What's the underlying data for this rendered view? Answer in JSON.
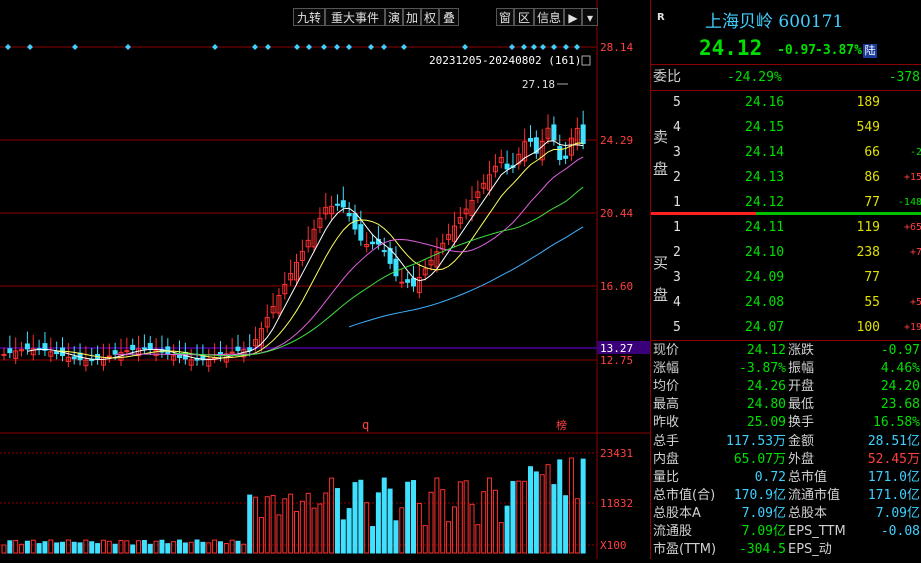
{
  "toolbar": {
    "items": [
      "九转",
      "重大事件",
      "演",
      "加",
      "权",
      "叠",
      "窗",
      "区",
      "信息"
    ]
  },
  "chart": {
    "price_ticks": [
      "28.14",
      "24.29",
      "20.44",
      "16.60",
      "12.75"
    ],
    "current_price_tag": "13.27",
    "range_label": "20231205-20240802 (161)",
    "high_label": "27.18",
    "q_marker": "q",
    "bang_marker": "榜",
    "vol_ticks": [
      "23431",
      "11832",
      "X100"
    ]
  },
  "quote": {
    "flag": "R",
    "name": "上海贝岭 600171",
    "price": "24.12",
    "change": "-0.97",
    "change_pct": "-3.87%",
    "market_badge": "陆",
    "weibi_label": "委比",
    "weibi": "-24.29%",
    "weicha": "-378",
    "sell_word": [
      "卖",
      "盘"
    ],
    "buy_word": [
      "买",
      "盘"
    ],
    "asks": [
      {
        "n": "5",
        "price": "24.16",
        "vol": "189",
        "chg": ""
      },
      {
        "n": "4",
        "price": "24.15",
        "vol": "549",
        "chg": ""
      },
      {
        "n": "3",
        "price": "24.14",
        "vol": "66",
        "chg": "-2"
      },
      {
        "n": "2",
        "price": "24.13",
        "vol": "86",
        "chg": "+15"
      },
      {
        "n": "1",
        "price": "24.12",
        "vol": "77",
        "chg": "-148"
      }
    ],
    "bids": [
      {
        "n": "1",
        "price": "24.11",
        "vol": "119",
        "chg": "+65"
      },
      {
        "n": "2",
        "price": "24.10",
        "vol": "238",
        "chg": "+7"
      },
      {
        "n": "3",
        "price": "24.09",
        "vol": "77",
        "chg": ""
      },
      {
        "n": "4",
        "price": "24.08",
        "vol": "55",
        "chg": "+5"
      },
      {
        "n": "5",
        "price": "24.07",
        "vol": "100",
        "chg": "+19"
      }
    ],
    "stats": [
      [
        "现价",
        "24.12",
        "涨跌",
        "-0.97"
      ],
      [
        "涨幅",
        "-3.87%",
        "振幅",
        "4.46%"
      ],
      [
        "均价",
        "24.26",
        "开盘",
        "24.20"
      ],
      [
        "最高",
        "24.80",
        "最低",
        "23.68"
      ],
      [
        "昨收",
        "25.09",
        "换手",
        "16.58%"
      ],
      [
        "总手",
        "117.53万",
        "金额",
        "28.51亿"
      ],
      [
        "内盘",
        "65.07万",
        "外盘",
        "52.45万"
      ],
      [
        "量比",
        "0.72",
        "总市值",
        "171.0亿"
      ],
      [
        "总市值(合)",
        "170.9亿",
        "流通市值",
        "171.0亿"
      ],
      [
        "总股本A",
        "7.09亿",
        "总股本",
        "7.09亿"
      ],
      [
        "流通股",
        "7.09亿",
        "EPS_TTM",
        "-0.08"
      ],
      [
        "市盈(TTM)",
        "-304.5",
        "EPS_动",
        ""
      ]
    ]
  },
  "colors": {
    "up": "#ff4040",
    "down": "#00e000",
    "accent": "#3fd0ff",
    "grid": "#8b0000"
  }
}
